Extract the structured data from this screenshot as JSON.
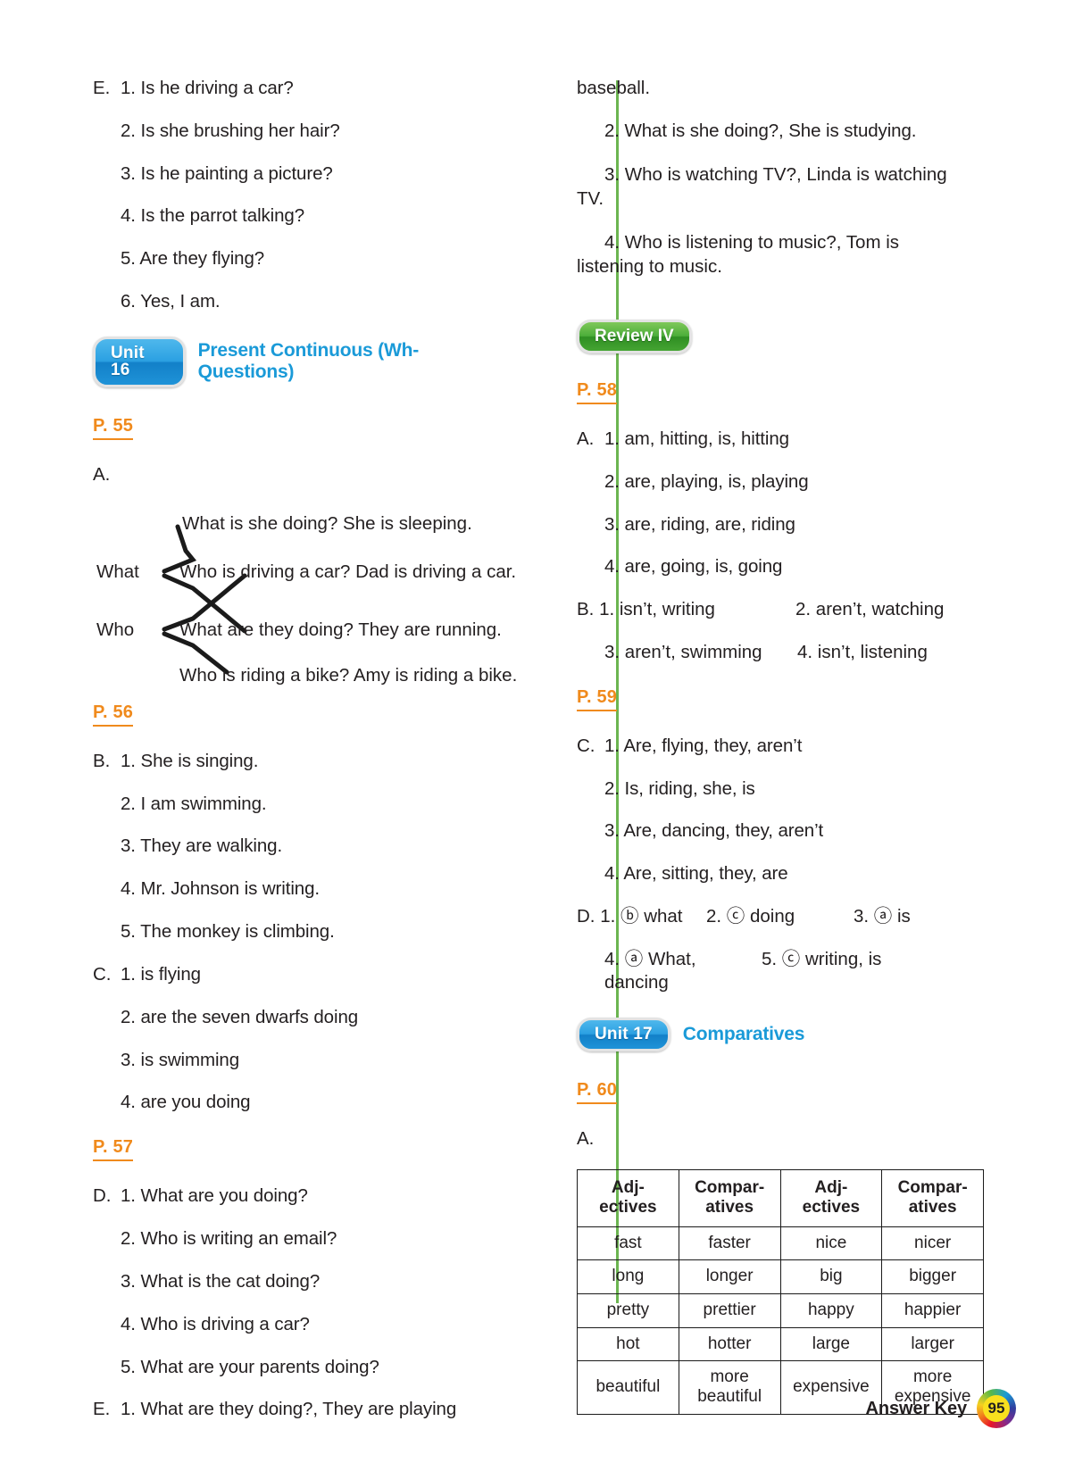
{
  "left_column": {
    "section_E_top": {
      "letter": "E.",
      "items": [
        "1. Is he driving a car?",
        "2. Is she brushing her hair?",
        "3. Is he painting a picture?",
        "4. Is the parrot talking?",
        "5. Are they flying?",
        "6. Yes, I am."
      ]
    },
    "unit16": {
      "badge": "Unit 16",
      "title": "Present Continuous (Wh- Questions)"
    },
    "p55": "P. 55",
    "section_A_match": {
      "letter": "A.",
      "left_items": [
        "What",
        "Who"
      ],
      "right_items": [
        "What is she doing? She is sleeping.",
        "Who is driving a car? Dad is driving a car.",
        "What are they doing? They are running.",
        "Who is riding a bike? Amy is riding a bike."
      ],
      "connections": [
        {
          "from": "What",
          "to": 0
        },
        {
          "from": "What",
          "to": 2
        },
        {
          "from": "Who",
          "to": 1
        },
        {
          "from": "Who",
          "to": 3
        }
      ]
    },
    "p56": "P. 56",
    "section_B": {
      "letter": "B.",
      "items": [
        "1. She is singing.",
        "2. I am swimming.",
        "3. They are walking.",
        "4. Mr. Johnson is writing.",
        "5. The monkey is climbing."
      ]
    },
    "section_C": {
      "letter": "C.",
      "items": [
        "1. is flying",
        "2. are the seven dwarfs doing",
        "3. is swimming",
        "4. are you doing"
      ]
    },
    "p57": "P. 57",
    "section_D": {
      "letter": "D.",
      "items": [
        "1. What are you doing?",
        "2. Who is writing an email?",
        "3. What is the cat doing?",
        "4. Who is driving a car?",
        "5. What are your parents doing?"
      ]
    },
    "section_E_bottom": {
      "letter": "E.",
      "item1_line1": "1. What are they doing?, They are playing"
    }
  },
  "right_column": {
    "continued": "baseball.",
    "section_E_cont": [
      "2. What is she doing?, She is studying.",
      {
        "line1": "3. Who is watching TV?, Linda is watching",
        "line2": "TV."
      },
      {
        "line1": "4. Who is listening to music?, Tom is",
        "line2": "listening to music."
      }
    ],
    "review": "Review IV",
    "p58": "P. 58",
    "section_A": {
      "letter": "A.",
      "items": [
        "1. am, hitting, is, hitting",
        "2. are, playing, is, playing",
        "3. are, riding, are, riding",
        "4. are, going, is, going"
      ]
    },
    "section_B": {
      "letter": "B.",
      "row1_left": "1. isn’t, writing",
      "row1_right": "2. aren’t, watching",
      "row2_left": "3. aren’t, swimming",
      "row2_right": "4. isn’t, listening"
    },
    "p59": "P. 59",
    "section_C": {
      "letter": "C.",
      "items": [
        "1. Are, flying, they, aren’t",
        "2. Is, riding, she, is",
        "3. Are, dancing, they, aren’t",
        "4. Are, sitting, they, are"
      ]
    },
    "section_D": {
      "letter": "D.",
      "row1_a": "1. ⓑ what",
      "row1_b": "2. ⓒ doing",
      "row1_c": "3. ⓐ is",
      "row2_a": "4. ⓐ What, dancing",
      "row2_b": "5. ⓒ writing, is"
    },
    "unit17": {
      "badge": "Unit 17",
      "title": "Comparatives"
    },
    "p60": "P. 60",
    "section_A_table": {
      "letter": "A.",
      "headers": [
        "Adj-\nectives",
        "Compar-\natives",
        "Adj-\nectives",
        "Compar-\natives"
      ],
      "header_parts": [
        [
          "Adj-",
          "ectives"
        ],
        [
          "Compar-",
          "atives"
        ],
        [
          "Adj-",
          "ectives"
        ],
        [
          "Compar-",
          "atives"
        ]
      ],
      "rows": [
        [
          "fast",
          "faster",
          "nice",
          "nicer"
        ],
        [
          "long",
          "longer",
          "big",
          "bigger"
        ],
        [
          "pretty",
          "prettier",
          "happy",
          "happier"
        ],
        [
          "hot",
          "hotter",
          "large",
          "larger"
        ],
        [
          "beautiful",
          "more\nbeautiful",
          "expensive",
          "more\nexpensive"
        ]
      ],
      "row_last_parts": [
        [
          "beautiful"
        ],
        [
          "more",
          "beautiful"
        ],
        [
          "expensive"
        ],
        [
          "more",
          "expensive"
        ]
      ]
    }
  },
  "footer": {
    "label": "Answer Key",
    "page_number": "95"
  },
  "colors": {
    "divider_green": "#6cb551",
    "page_orange": "#f08a1c",
    "unit_blue": "#1a9ad8",
    "review_green": "#45a432",
    "text": "#231f20"
  }
}
